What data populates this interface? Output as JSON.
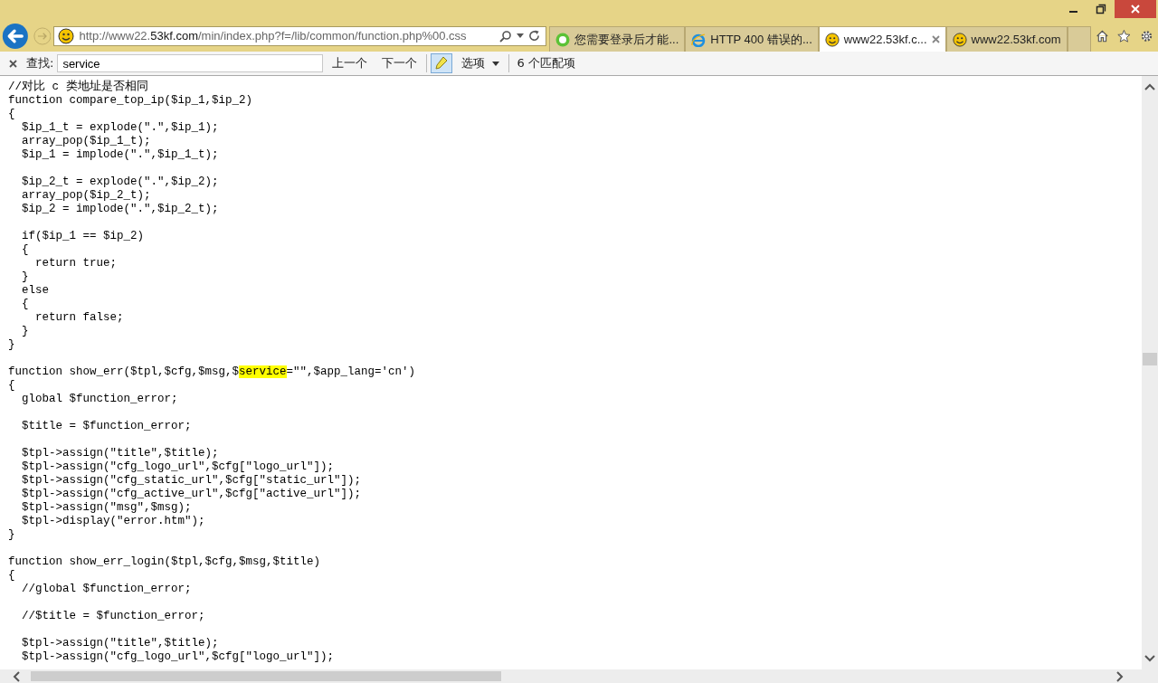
{
  "address_bar": {
    "url_prefix": "http://www22.",
    "url_domain": "53kf.com",
    "url_path": "/min/index.php?f=/lib/common/function.php%00.css"
  },
  "tabs": [
    {
      "label": "您需要登录后才能...",
      "selected": false,
      "kind": "green"
    },
    {
      "label": "HTTP 400 错误的...",
      "selected": false,
      "kind": "ie"
    },
    {
      "label": "www22.53kf.c...",
      "selected": true,
      "kind": "smiley"
    },
    {
      "label": "www22.53kf.com",
      "selected": false,
      "kind": "smiley"
    }
  ],
  "find_bar": {
    "label": "查找:",
    "value": "service",
    "previous": "上一个",
    "next": "下一个",
    "highlight_on": true,
    "options": "选项",
    "match_count": "6 个匹配项"
  },
  "code_lines": [
    {
      "kind": "text",
      "text": "//对比 c 类地址是否相同"
    },
    {
      "kind": "text",
      "text": "function compare_top_ip($ip_1,$ip_2)"
    },
    {
      "kind": "text",
      "text": "{"
    },
    {
      "kind": "text",
      "text": "  $ip_1_t = explode(\".\",$ip_1);"
    },
    {
      "kind": "text",
      "text": "  array_pop($ip_1_t);"
    },
    {
      "kind": "text",
      "text": "  $ip_1 = implode(\".\",$ip_1_t);"
    },
    {
      "kind": "blank"
    },
    {
      "kind": "text",
      "text": "  $ip_2_t = explode(\".\",$ip_2);"
    },
    {
      "kind": "text",
      "text": "  array_pop($ip_2_t);"
    },
    {
      "kind": "text",
      "text": "  $ip_2 = implode(\".\",$ip_2_t);"
    },
    {
      "kind": "blank"
    },
    {
      "kind": "text",
      "text": "  if($ip_1 == $ip_2)"
    },
    {
      "kind": "text",
      "text": "  {"
    },
    {
      "kind": "text",
      "text": "    return true;"
    },
    {
      "kind": "text",
      "text": "  }"
    },
    {
      "kind": "text",
      "text": "  else"
    },
    {
      "kind": "text",
      "text": "  {"
    },
    {
      "kind": "text",
      "text": "    return false;"
    },
    {
      "kind": "text",
      "text": "  }"
    },
    {
      "kind": "text",
      "text": "}"
    },
    {
      "kind": "blank"
    },
    {
      "kind": "match",
      "before": "function show_err($tpl,$cfg,$msg,$",
      "match": "service",
      "after": "=\"\",$app_lang='cn')"
    },
    {
      "kind": "text",
      "text": "{"
    },
    {
      "kind": "text",
      "text": "  global $function_error;"
    },
    {
      "kind": "blank"
    },
    {
      "kind": "text",
      "text": "  $title = $function_error;"
    },
    {
      "kind": "blank"
    },
    {
      "kind": "text",
      "text": "  $tpl->assign(\"title\",$title);"
    },
    {
      "kind": "text",
      "text": "  $tpl->assign(\"cfg_logo_url\",$cfg[\"logo_url\"]);"
    },
    {
      "kind": "text",
      "text": "  $tpl->assign(\"cfg_static_url\",$cfg[\"static_url\"]);"
    },
    {
      "kind": "text",
      "text": "  $tpl->assign(\"cfg_active_url\",$cfg[\"active_url\"]);"
    },
    {
      "kind": "text",
      "text": "  $tpl->assign(\"msg\",$msg);"
    },
    {
      "kind": "text",
      "text": "  $tpl->display(\"error.htm\");"
    },
    {
      "kind": "text",
      "text": "}"
    },
    {
      "kind": "blank"
    },
    {
      "kind": "text",
      "text": "function show_err_login($tpl,$cfg,$msg,$title)"
    },
    {
      "kind": "text",
      "text": "{"
    },
    {
      "kind": "text",
      "text": "  //global $function_error;"
    },
    {
      "kind": "blank"
    },
    {
      "kind": "text",
      "text": "  //$title = $function_error;"
    },
    {
      "kind": "blank"
    },
    {
      "kind": "text",
      "text": "  $tpl->assign(\"title\",$title);"
    },
    {
      "kind": "text",
      "text": "  $tpl->assign(\"cfg_logo_url\",$cfg[\"logo_url\"]);"
    }
  ]
}
